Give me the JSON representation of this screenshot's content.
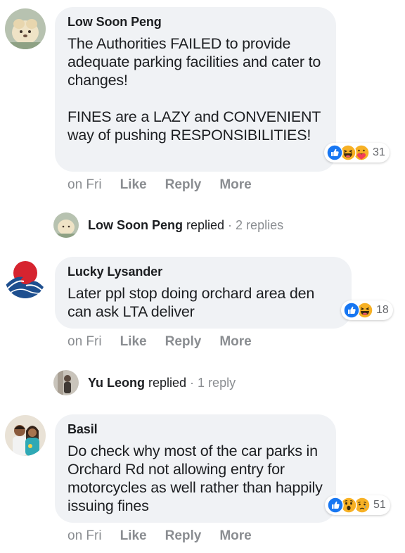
{
  "comments": [
    {
      "author": "Low Soon Peng",
      "text": "The Authorities FAILED to provide adequate parking facilities and cater to changes!\n\nFINES are a LAZY and CONVENIENT way of pushing RESPONSIBILITIES!",
      "reaction_icons": [
        "like-icon",
        "haha-icon",
        "care-icon"
      ],
      "reaction_count": "31",
      "time": "on Fri",
      "actions": [
        "Like",
        "Reply",
        "More"
      ],
      "replies": {
        "name": "Low Soon Peng",
        "verb": "replied",
        "dot": "·",
        "count": "2 replies"
      }
    },
    {
      "author": "Lucky Lysander",
      "text": "Later ppl stop doing orchard area den can ask LTA deliver",
      "reaction_icons": [
        "like-icon",
        "haha-icon"
      ],
      "reaction_count": "18",
      "time": "on Fri",
      "actions": [
        "Like",
        "Reply",
        "More"
      ],
      "replies": {
        "name": "Yu Leong",
        "verb": "replied",
        "dot": "·",
        "count": "1 reply"
      }
    },
    {
      "author": "Basil",
      "text": "Do check why most of the car parks in Orchard Rd not allowing entry for motorcycles as well rather than happily issuing fines",
      "reaction_icons": [
        "like-icon",
        "wow-icon",
        "sad-icon"
      ],
      "reaction_count": "51",
      "time": "on Fri",
      "actions": [
        "Like",
        "Reply",
        "More"
      ]
    }
  ],
  "colors": {
    "bubble": "#f0f2f5",
    "meta_text": "#8a8d91",
    "like_blue": "#1877f2",
    "reaction_yellow": "#f7b125"
  }
}
